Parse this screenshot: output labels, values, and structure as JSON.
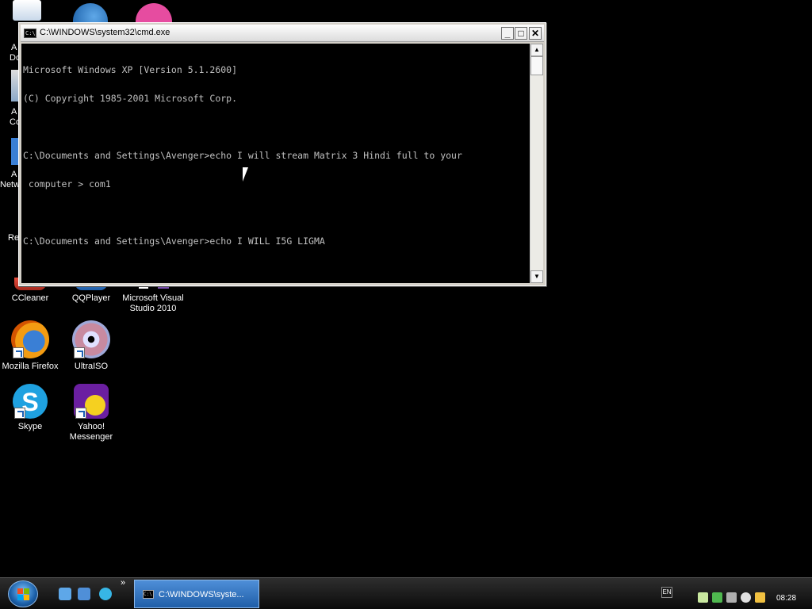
{
  "window": {
    "title": "C:\\WINDOWS\\system32\\cmd.exe",
    "min_glyph": "_",
    "max_glyph": "□",
    "close_glyph": "✕"
  },
  "console": {
    "lines": [
      "Microsoft Windows XP [Version 5.1.2600]",
      "(C) Copyright 1985-2001 Microsoft Corp.",
      "",
      "C:\\Documents and Settings\\Avenger>echo I will stream Matrix 3 Hindi full to your",
      " computer > com1",
      "",
      "C:\\Documents and Settings\\Avenger>echo I WILL I5G LIGMA"
    ]
  },
  "desktop": {
    "partial_labels": [
      "A",
      "Do",
      "A",
      "Co",
      "A",
      "Netw",
      "Re"
    ],
    "icons": [
      {
        "label": "CCleaner",
        "color": "#d9352b"
      },
      {
        "label": "QQPlayer",
        "color": "#3a7fd5"
      },
      {
        "label": "Microsoft Visual Studio 2010",
        "color": "#7a4fb0"
      },
      {
        "label": "Mozilla Firefox",
        "color": "#e8732a"
      },
      {
        "label": "UltraISO",
        "color": "#b9b9c9"
      },
      {
        "label": "Skype",
        "color": "#1fa1e0"
      },
      {
        "label": "Yahoo! Messenger",
        "color": "#6b1fa1"
      }
    ]
  },
  "taskbar": {
    "active_task": "C:\\WINDOWS\\syste...",
    "cmd_icon_text": "C:\\",
    "chevron": "»",
    "language": "EN",
    "clock": "08:28"
  },
  "colors": {
    "console_bg": "#000000",
    "console_fg": "#c0c0c0",
    "taskbar_active": "#1f5ea8"
  }
}
